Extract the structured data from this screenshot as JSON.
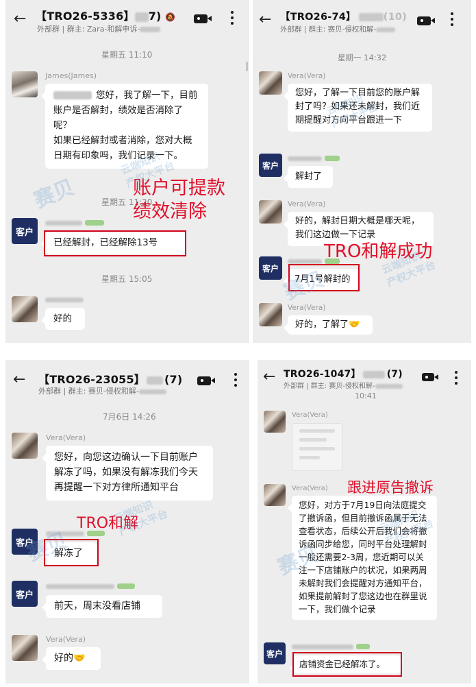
{
  "panel1": {
    "title": "【TRO26-5336】",
    "title_count": "7)",
    "subtitle": "外部群 | 群主: Zara-和解申诉-",
    "time1": "星期五 11:10",
    "james_name": "James(James)",
    "msg1": "您好，我了解一下，目前账户是否解封，绩效是否消除了呢？\n如果已经解封或者消除，您对大概日期有印象吗，我们记录一下。",
    "time2": "星期五 11:20",
    "customer_label": "客户",
    "msg2": "已经解封，已经解除13号",
    "time3": "星期五 15:05",
    "msg3": "好的",
    "annotation": "账户可提款\n绩效清除",
    "watermark": "赛贝",
    "watermark2": "云端知识\n产权大平台"
  },
  "panel2": {
    "title": "【TRO26-74】",
    "title_tail": "(10)",
    "subtitle": "外部群 | 群主: 赛贝-侵权和解-",
    "time1": "星期一 14:32",
    "vera_name": "Vera(Vera)",
    "msg1": "您好，了解一下目前您的账户解封了吗？如果还未解封，我们近期提醒对方向平台跟进一下",
    "customer_label": "客户",
    "msg2": "解封了",
    "msg3": "好的，解封日期大概是哪天呢，我们这边做一下记录",
    "msg4": "7月1号解封的",
    "msg5": "好的，了解了🤝",
    "annotation": "TRO和解成功",
    "watermark": "赛贝",
    "watermark2": "云端知识\n产权大平台"
  },
  "panel3": {
    "title": "【TRO26-23055】",
    "title_count": "(7)",
    "subtitle": "外部群 | 群主: 赛贝-侵权和解-",
    "time1": "7月6日 14:26",
    "vera_name": "Vera(Vera)",
    "msg1": "您好，向您这边确认一下目前账户解冻了吗，如果没有解冻我们今天再提醒一下对方律所通知平台",
    "customer_label": "客户",
    "msg2": "解冻了",
    "msg3": "前天，周末没看店铺",
    "msg4": "好的🤝",
    "annotation": "TRO和解",
    "watermark": "赛贝",
    "watermark2": "云端知识\n产权大平台"
  },
  "panel4": {
    "title": "TRO26-1047】",
    "title_count": "(7)",
    "subtitle": "外部群 | 群主: 赛贝-侵权和解-",
    "time1": "10:41",
    "vera_name": "Vera(Vera)",
    "msg1": "您好，对方于7月19日向法庭提交了撤诉函，但目前撤诉函属于无法查看状态，后续公开后我们会将撤诉函同步给您，同时平台处理解封一般还需要2-3周，您近期可以关注一下店铺账户的状况，如果两周未解封我们会提醒对方通知平台，如果提前解封了您这边也在群里说一下，我们做个记录",
    "customer_label": "客户",
    "msg2": "店铺资金已经解冻了。",
    "annotation": "跟进原告撤诉",
    "watermark": "赛贝",
    "watermark2": "云端知识\n产权大平台"
  },
  "icons": {
    "back": "back-arrow-icon",
    "video": "video-call-icon",
    "more": "more-vertical-icon"
  }
}
